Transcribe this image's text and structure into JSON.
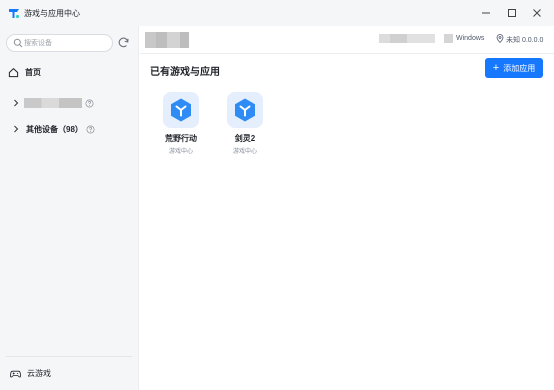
{
  "window": {
    "title": "游戏与应用中心",
    "controls": [
      "minimize",
      "maximize",
      "close"
    ]
  },
  "sidebar": {
    "search": {
      "placeholder": "搜索设备",
      "value": ""
    },
    "home_label": "首页",
    "device_groups": [
      {
        "label": "",
        "redacted": true
      },
      {
        "label": "其他设备（98）",
        "redacted": false
      }
    ],
    "cloud_label": "云游戏"
  },
  "main": {
    "device_info": {
      "os": "Windows",
      "location": "未知 0.0.0.0"
    },
    "section_title": "已有游戏与应用",
    "add_button_label": "添加应用",
    "apps": [
      {
        "name": "荒野行动",
        "source": "游戏中心"
      },
      {
        "name": "剑灵2",
        "source": "游戏中心"
      }
    ]
  },
  "colors": {
    "accent": "#1677ff",
    "app_icon_bg": "#e4eefc",
    "sidebar_bg": "#f5f6f8"
  }
}
